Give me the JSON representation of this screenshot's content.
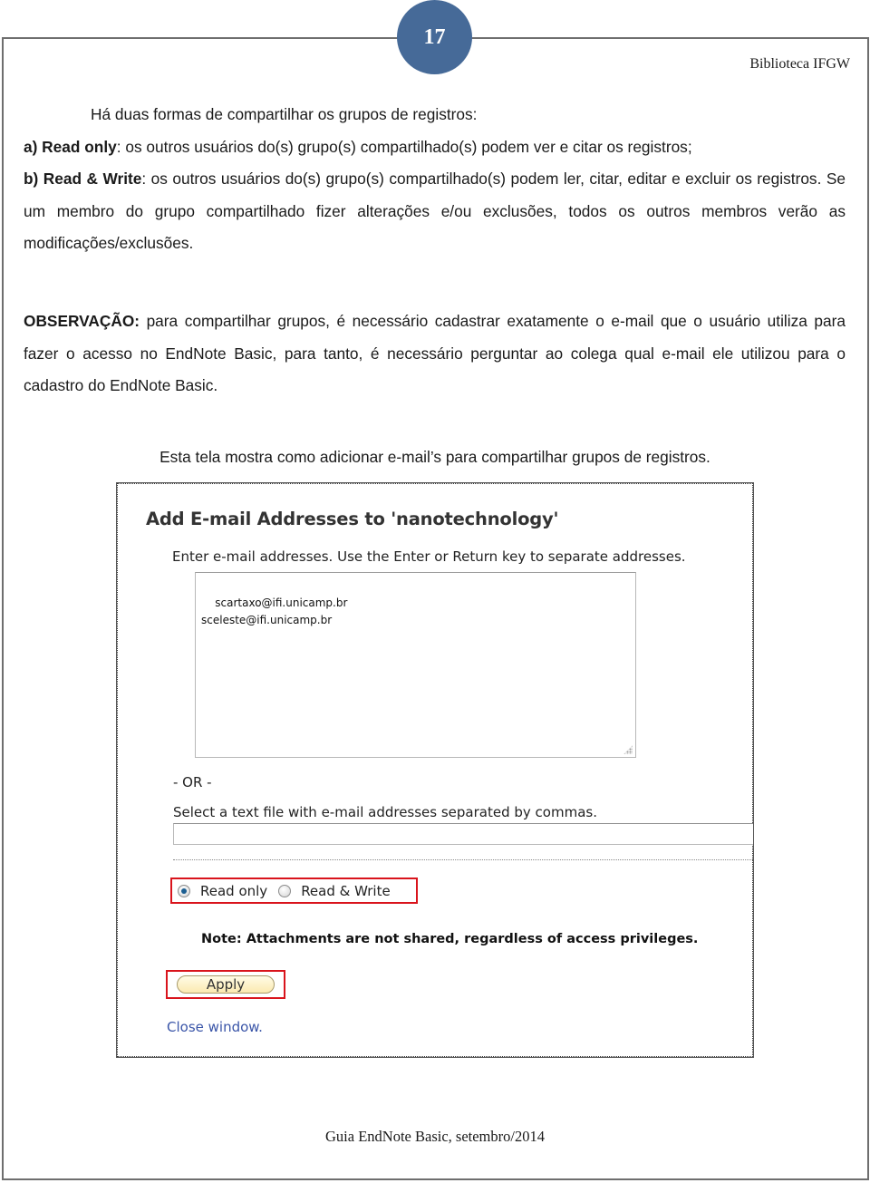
{
  "page": {
    "number": "17",
    "header_right": "Biblioteca IFGW",
    "footer": "Guia EndNote Basic, setembro/2014",
    "badge_color": "#466a98"
  },
  "content": {
    "intro": "Há duas formas de compartilhar os grupos de registros:",
    "item_a": {
      "label": "a) Read only",
      "text": ": os outros usuários do(s) grupo(s) compartilhado(s) podem ver e citar os registros;"
    },
    "item_b": {
      "label": "b) Read & Write",
      "text": ": os outros usuários do(s) grupo(s) compartilhado(s)  podem ler, citar, editar e excluir os registros. Se um membro do grupo compartilhado fizer alterações e/ou exclusões, todos os outros membros verão as modificações/exclusões."
    },
    "observation": {
      "label": "OBSERVAÇÃO:",
      "text": " para compartilhar grupos, é necessário cadastrar exatamente o e-mail que o usuário utiliza para fazer o acesso no EndNote Basic, para tanto, é necessário perguntar ao colega qual e-mail ele utilizou para o cadastro do EndNote Basic."
    },
    "caption": "Esta tela mostra como adicionar e-mail’s para compartilhar grupos de registros."
  },
  "screenshot": {
    "title": "Add E-mail Addresses to 'nanotechnology'",
    "instruction": "Enter e-mail addresses. Use the Enter or Return key to separate addresses.",
    "emails_value": "scartaxo@ifi.unicamp.br\nsceleste@ifi.unicamp.br",
    "or_label": "- OR -",
    "file_label": "Select a text file with e-mail addresses separated by commas.",
    "file_value": "",
    "access_options": [
      {
        "label": "Read only",
        "checked": true
      },
      {
        "label": "Read & Write",
        "checked": false
      }
    ],
    "note": "Note: Attachments are not shared, regardless of access privileges.",
    "apply_label": "Apply",
    "close_label": "Close window.",
    "highlight_color": "#d9141c",
    "link_color": "#3a55a8"
  }
}
